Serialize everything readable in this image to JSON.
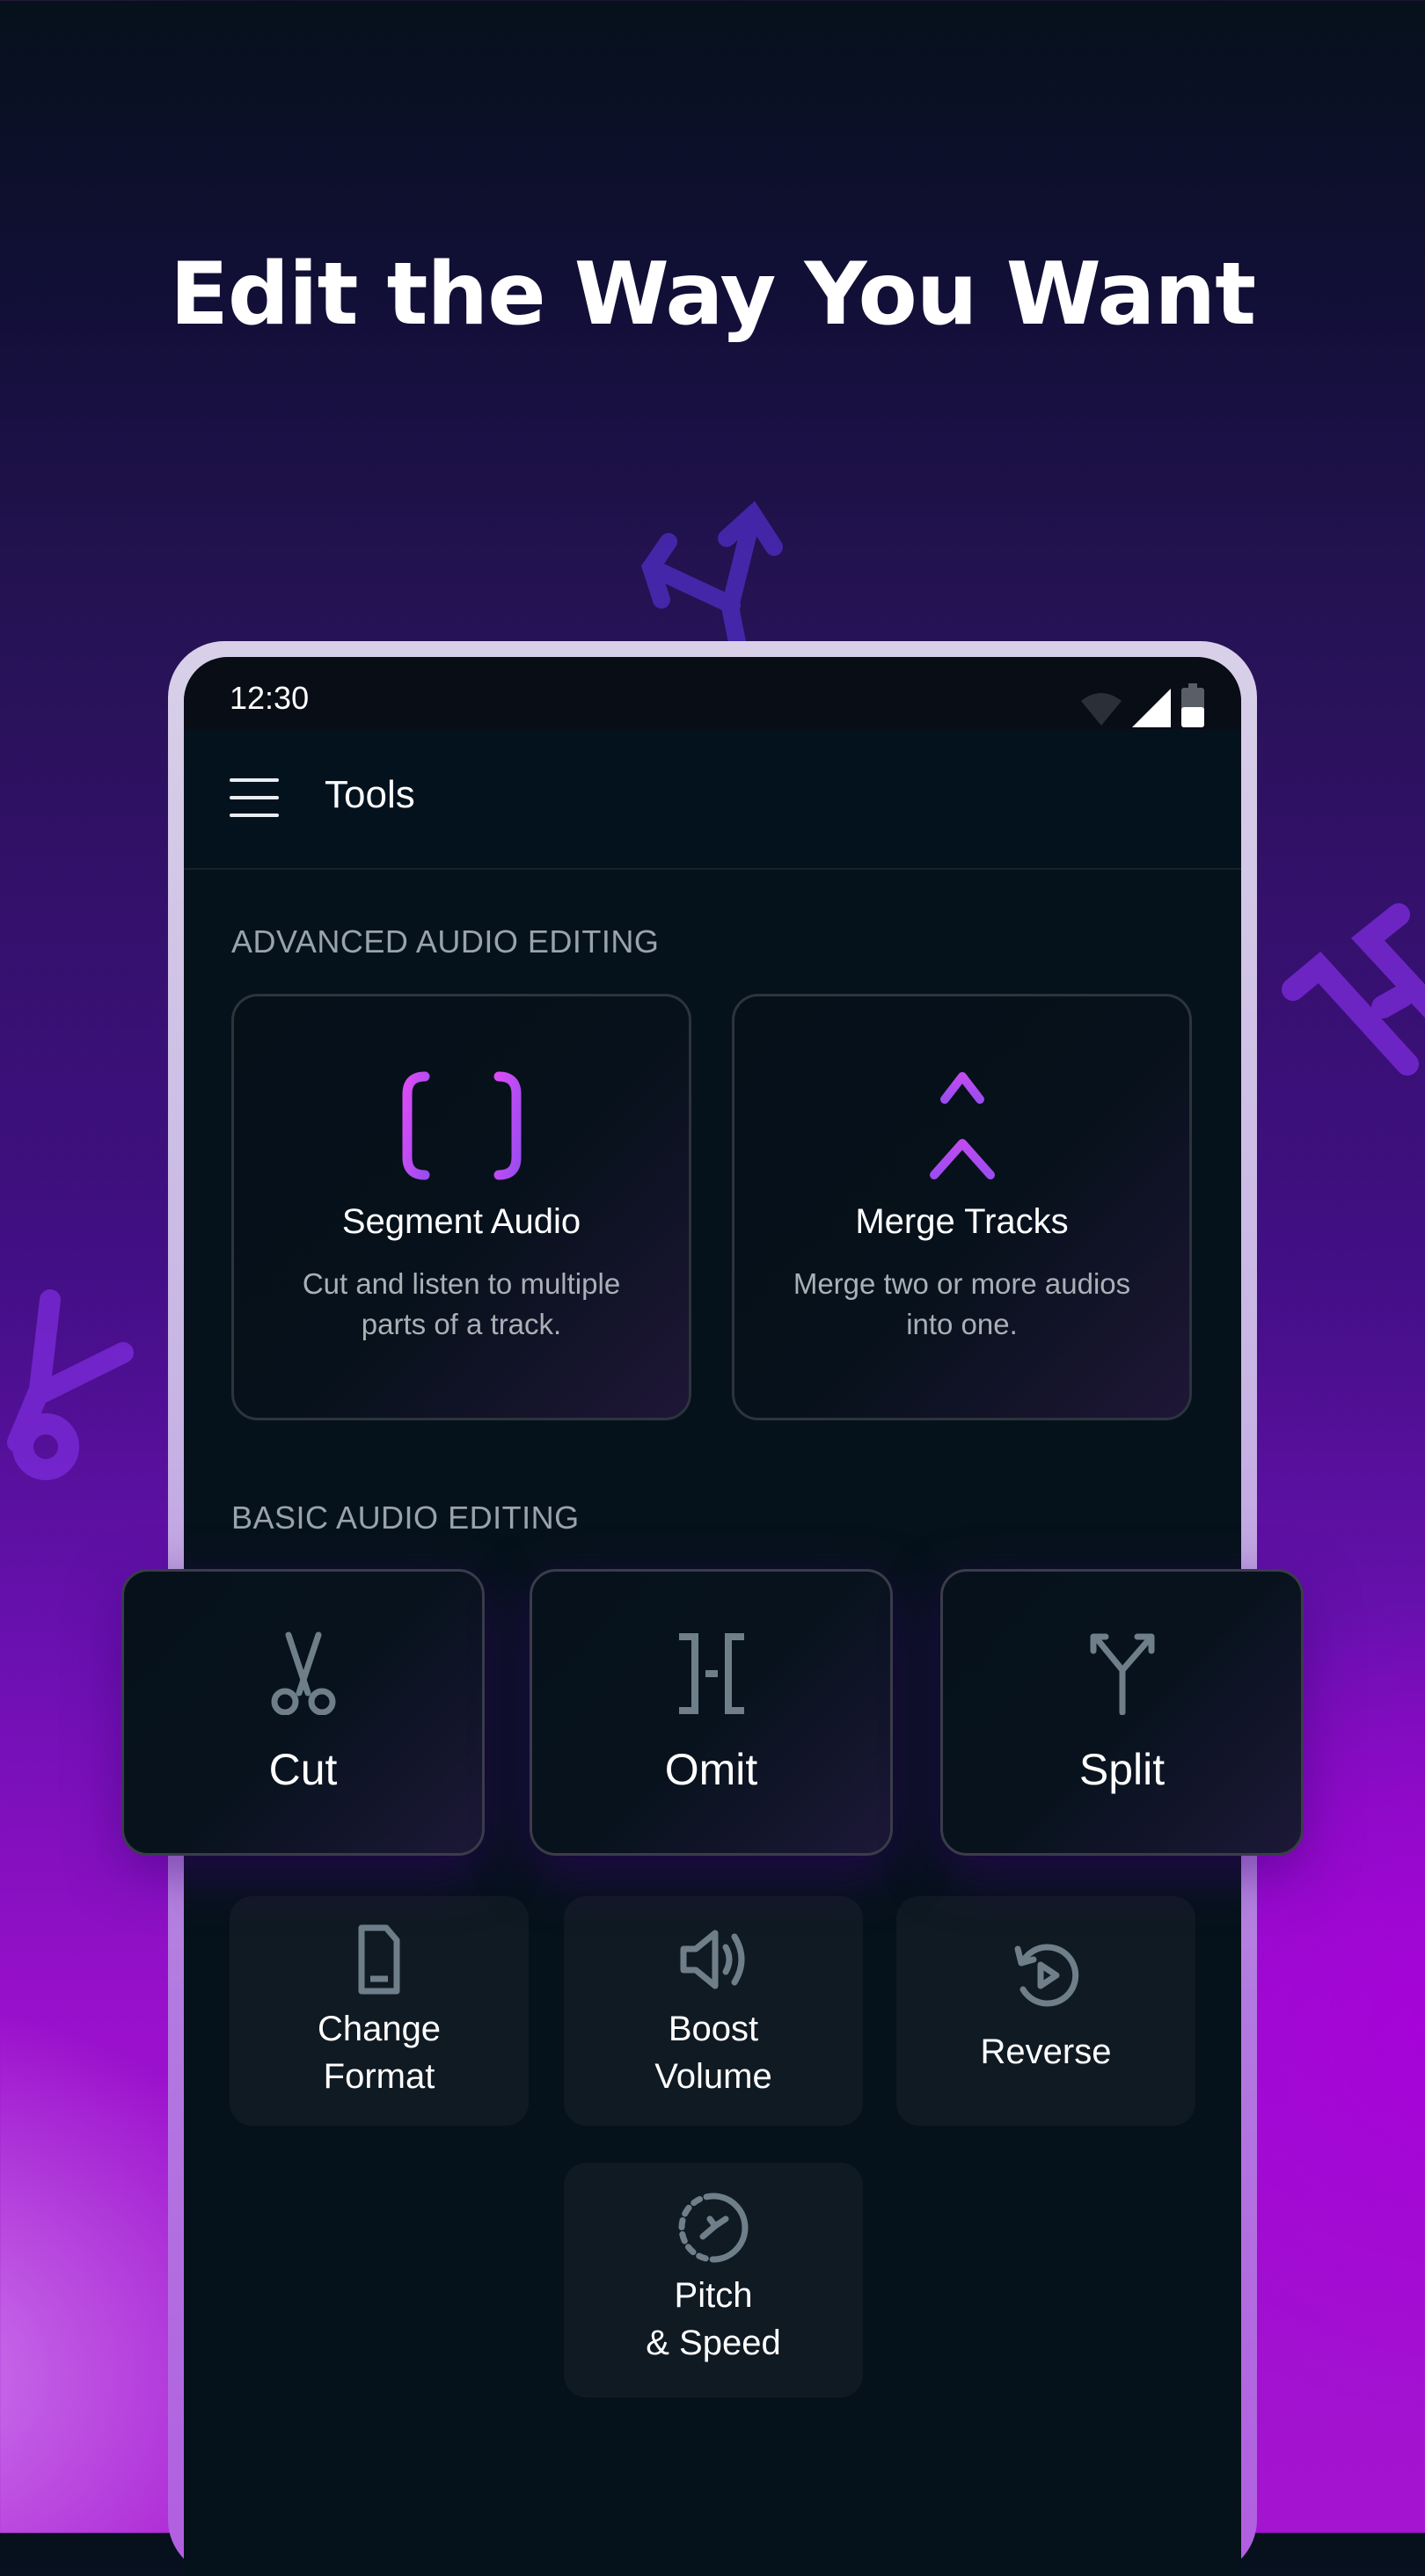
{
  "headline": "Edit the Way You Want",
  "status_bar": {
    "time": "12:30",
    "icons": [
      "wifi-icon",
      "signal-icon",
      "battery-icon"
    ]
  },
  "app_bar": {
    "menu_icon": "hamburger-menu-icon",
    "title": "Tools"
  },
  "advanced_section": {
    "label": "ADVANCED AUDIO EDITING",
    "accent_color": "#b14cf0",
    "cards": [
      {
        "icon": "segment-audio-icon",
        "title": "Segment Audio",
        "description": "Cut and listen to multiple parts of a track."
      },
      {
        "icon": "merge-tracks-icon",
        "title": "Merge Tracks",
        "description": "Merge two or more audios into one."
      }
    ]
  },
  "basic_section": {
    "label": "BASIC AUDIO EDITING",
    "icon_color": "#6f7f8a",
    "featured_tools": [
      {
        "icon": "scissors-icon",
        "label": "Cut"
      },
      {
        "icon": "omit-icon",
        "label": "Omit"
      },
      {
        "icon": "split-icon",
        "label": "Split"
      }
    ],
    "tools": [
      {
        "icon": "file-format-icon",
        "label_line1": "Change",
        "label_line2": "Format"
      },
      {
        "icon": "volume-icon",
        "label_line1": "Boost",
        "label_line2": "Volume"
      },
      {
        "icon": "reverse-icon",
        "label_line1": "Reverse",
        "label_line2": ""
      },
      {
        "icon": "pitch-speed-icon",
        "label_line1": "Pitch",
        "label_line2": "& Speed"
      }
    ]
  }
}
